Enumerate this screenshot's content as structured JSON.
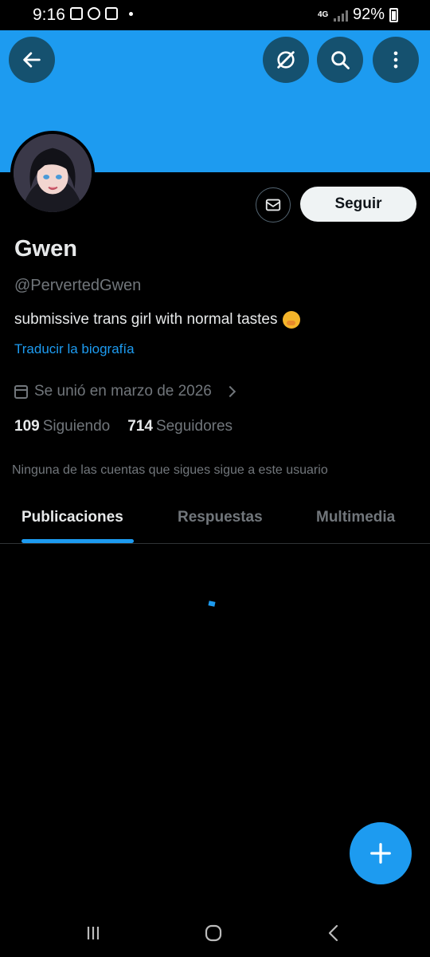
{
  "status_bar": {
    "time": "9:16",
    "network": "4G",
    "battery": "92%"
  },
  "banner": {
    "color": "#1d9bf0"
  },
  "icons": {
    "back": "back-arrow-icon",
    "grok": "grok-icon",
    "search": "search-icon",
    "more": "more-vertical-icon",
    "message": "mail-icon",
    "calendar": "calendar-icon",
    "compose": "plus-icon"
  },
  "profile": {
    "name": "Gwen",
    "handle": "@PervertedGwen",
    "bio": "submissive trans girl with normal tastes",
    "translate_bio": "Traducir la biografía",
    "joined": "Se unió en marzo de 2026",
    "following_count": "109",
    "following_label": "Siguiendo",
    "followers_count": "714",
    "followers_label": "Seguidores",
    "mutuals_note": "Ninguna de las cuentas que sigues sigue a este usuario"
  },
  "actions": {
    "follow_label": "Seguir"
  },
  "tabs": [
    {
      "label": "Publicaciones",
      "active": true
    },
    {
      "label": "Respuestas",
      "active": false
    },
    {
      "label": "Multimedia",
      "active": false
    }
  ],
  "colors": {
    "accent": "#1d9bf0",
    "background": "#000000",
    "secondary_text": "#71767b"
  }
}
